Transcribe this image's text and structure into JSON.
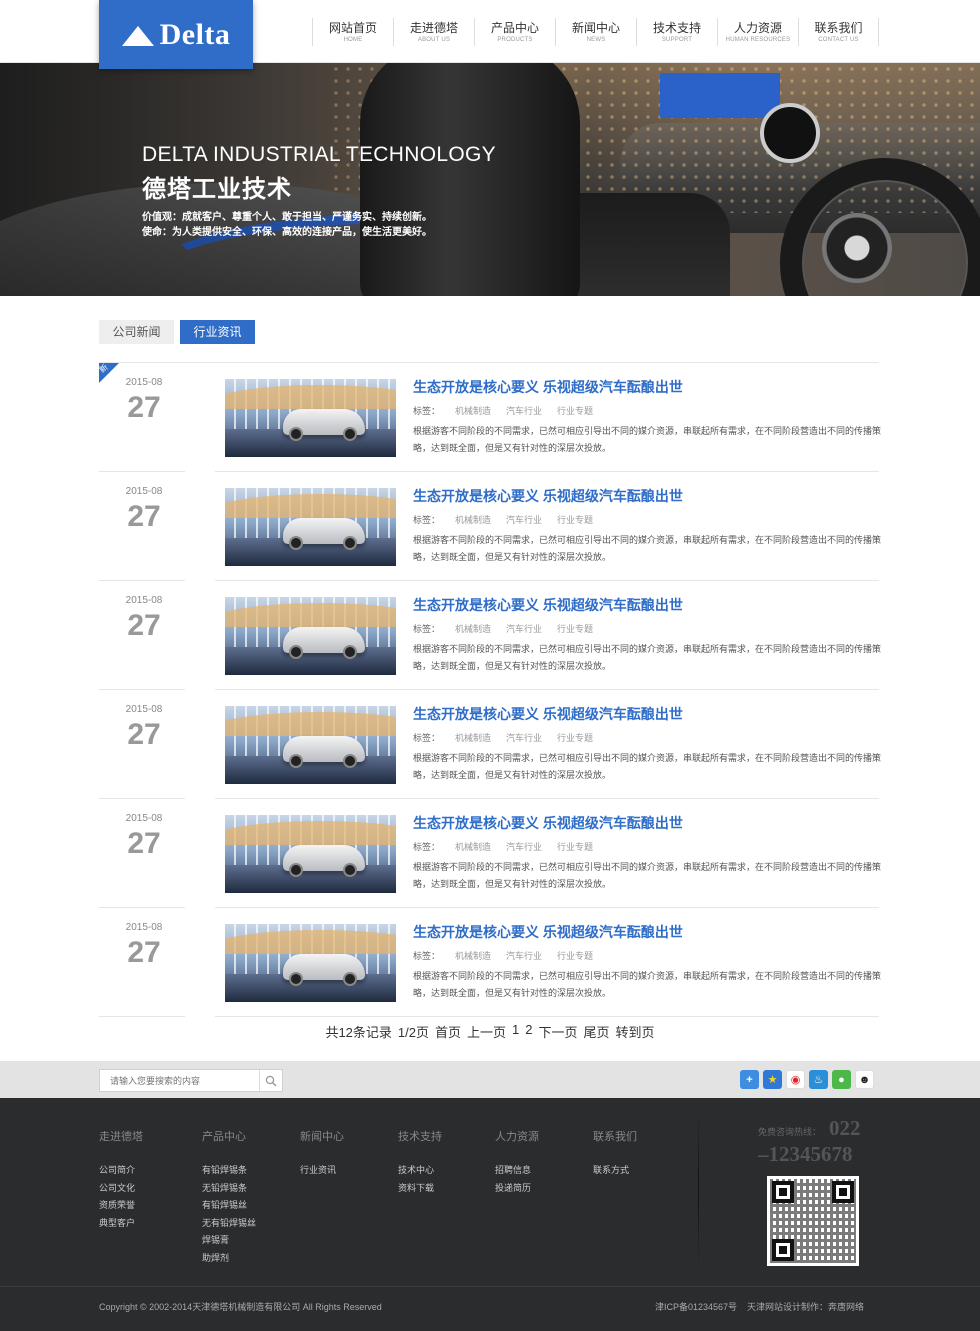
{
  "header": {
    "logo_text": "Delta",
    "nav": [
      {
        "cn": "网站首页",
        "en": "HOME"
      },
      {
        "cn": "走进德塔",
        "en": "ABOUT US"
      },
      {
        "cn": "产品中心",
        "en": "PRODUCTS"
      },
      {
        "cn": "新闻中心",
        "en": "NEWS"
      },
      {
        "cn": "技术支持",
        "en": "SUPPORT"
      },
      {
        "cn": "人力资源",
        "en": "HUMAN RESOURCES"
      },
      {
        "cn": "联系我们",
        "en": "CONTACT US"
      }
    ]
  },
  "banner": {
    "title_en": "DELTA  INDUSTRIAL TECHNOLOGY",
    "title_cn": "德塔工业技术",
    "line1": "价值观：成就客户、尊重个人、敢于担当、严谨务实、持续创新。",
    "line2": "使命：为人类提供安全、环保、高效的连接产品，使生活更美好。"
  },
  "tabs": [
    {
      "label": "公司新闻",
      "active": false
    },
    {
      "label": "行业资讯",
      "active": true
    }
  ],
  "news": {
    "new_badge": "新",
    "tag_label": "标签：",
    "items": [
      {
        "ym": "2015-08",
        "day": "27",
        "title": "生态开放是核心要义 乐视超级汽车酝酿出世",
        "tags": [
          "机械制造",
          "汽车行业",
          "行业专题"
        ],
        "desc": "根据游客不同阶段的不同需求，已然可相应引导出不同的媒介资源，串联起所有需求，在不同阶段营造出不同的传播策略，达到既全面，但是又有针对性的深层次投放。"
      },
      {
        "ym": "2015-08",
        "day": "27",
        "title": "生态开放是核心要义 乐视超级汽车酝酿出世",
        "tags": [
          "机械制造",
          "汽车行业",
          "行业专题"
        ],
        "desc": "根据游客不同阶段的不同需求，已然可相应引导出不同的媒介资源，串联起所有需求，在不同阶段营造出不同的传播策略，达到既全面，但是又有针对性的深层次投放。"
      },
      {
        "ym": "2015-08",
        "day": "27",
        "title": "生态开放是核心要义 乐视超级汽车酝酿出世",
        "tags": [
          "机械制造",
          "汽车行业",
          "行业专题"
        ],
        "desc": "根据游客不同阶段的不同需求，已然可相应引导出不同的媒介资源，串联起所有需求，在不同阶段营造出不同的传播策略，达到既全面，但是又有针对性的深层次投放。"
      },
      {
        "ym": "2015-08",
        "day": "27",
        "title": "生态开放是核心要义 乐视超级汽车酝酿出世",
        "tags": [
          "机械制造",
          "汽车行业",
          "行业专题"
        ],
        "desc": "根据游客不同阶段的不同需求，已然可相应引导出不同的媒介资源，串联起所有需求，在不同阶段营造出不同的传播策略，达到既全面，但是又有针对性的深层次投放。"
      },
      {
        "ym": "2015-08",
        "day": "27",
        "title": "生态开放是核心要义 乐视超级汽车酝酿出世",
        "tags": [
          "机械制造",
          "汽车行业",
          "行业专题"
        ],
        "desc": "根据游客不同阶段的不同需求，已然可相应引导出不同的媒介资源，串联起所有需求，在不同阶段营造出不同的传播策略，达到既全面，但是又有针对性的深层次投放。"
      },
      {
        "ym": "2015-08",
        "day": "27",
        "title": "生态开放是核心要义 乐视超级汽车酝酿出世",
        "tags": [
          "机械制造",
          "汽车行业",
          "行业专题"
        ],
        "desc": "根据游客不同阶段的不同需求，已然可相应引导出不同的媒介资源，串联起所有需求，在不同阶段营造出不同的传播策略，达到既全面，但是又有针对性的深层次投放。"
      }
    ]
  },
  "pager": {
    "summary": "共12条记录",
    "page_of": "1/2页",
    "first": "首页",
    "prev": "上一页",
    "p1": "1",
    "p2": "2",
    "next": "下一页",
    "last": "尾页",
    "goto": "转到页"
  },
  "search": {
    "placeholder": "请输入您要搜索的内容"
  },
  "share_icons": [
    "plus-share-icon",
    "star-favorite-icon",
    "weibo-icon",
    "qq-space-icon",
    "wechat-icon",
    "qq-icon"
  ],
  "footer": {
    "columns": [
      {
        "head": "走进德塔",
        "links": [
          "公司简介",
          "公司文化",
          "资质荣誉",
          "典型客户"
        ]
      },
      {
        "head": "产品中心",
        "links": [
          "有铅焊锡条",
          "无铅焊锡条",
          "有铅焊锡丝",
          "无有铅焊锡丝",
          "焊锡膏",
          "助焊剂"
        ]
      },
      {
        "head": "新闻中心",
        "links": [
          "行业资讯"
        ]
      },
      {
        "head": "技术支持",
        "links": [
          "技术中心",
          "资料下载"
        ]
      },
      {
        "head": "人力资源",
        "links": [
          "招聘信息",
          "投递简历"
        ]
      },
      {
        "head": "联系我们",
        "links": [
          "联系方式"
        ]
      }
    ],
    "hotline_label": "免费咨询热线：",
    "hotline_1": "022",
    "hotline_2": "–12345678",
    "copyright": "Copyright © 2002-2014天津德塔机械制造有限公司 All Rights Reserved",
    "icp": "津ICP备01234567号",
    "design": "天津网站设计制作：奔唐网络"
  },
  "colors": {
    "accent": "#2f6dc8",
    "footer_bg": "#2b2c2e"
  }
}
